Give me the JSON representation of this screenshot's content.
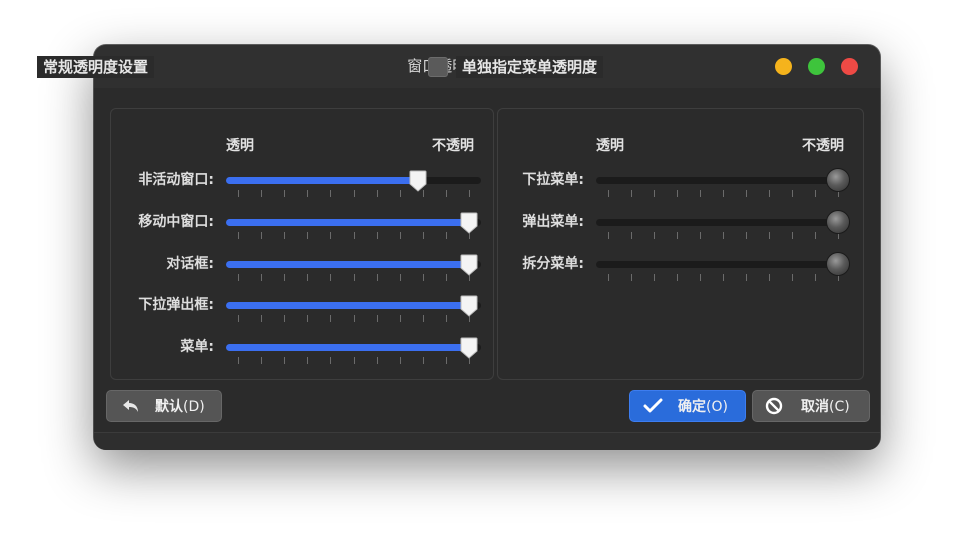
{
  "window": {
    "title": "窗口透明度 — 系统设置",
    "controls": [
      "minimize",
      "maximize",
      "close"
    ],
    "colors": {
      "minimize": "#f5b31c",
      "maximize": "#3ec43c",
      "close": "#ee4a45"
    }
  },
  "general": {
    "title": "常规透明度设置",
    "min_label": "透明",
    "max_label": "不透明",
    "sliders": [
      {
        "label": "非活动窗口:",
        "value": 0.78
      },
      {
        "label": "移动中窗口:",
        "value": 1.0
      },
      {
        "label": "对话框:",
        "value": 1.0
      },
      {
        "label": "下拉弹出框:",
        "value": 1.0
      },
      {
        "label": "菜单:",
        "value": 1.0
      }
    ]
  },
  "menu_specific": {
    "title": "单独指定菜单透明度",
    "checked": false,
    "enabled": false,
    "min_label": "透明",
    "max_label": "不透明",
    "sliders": [
      {
        "label": "下拉菜单:",
        "value": 1.0
      },
      {
        "label": "弹出菜单:",
        "value": 1.0
      },
      {
        "label": "拆分菜单:",
        "value": 1.0
      }
    ]
  },
  "buttons": {
    "defaults": {
      "label": "默认",
      "shortcut": "(D)",
      "icon": "undo-icon"
    },
    "ok": {
      "label": "确定",
      "shortcut": "(O)",
      "icon": "check-icon"
    },
    "cancel": {
      "label": "取消",
      "shortcut": "(C)",
      "icon": "cancel-icon"
    }
  },
  "accent_color": "#3b6ff0"
}
